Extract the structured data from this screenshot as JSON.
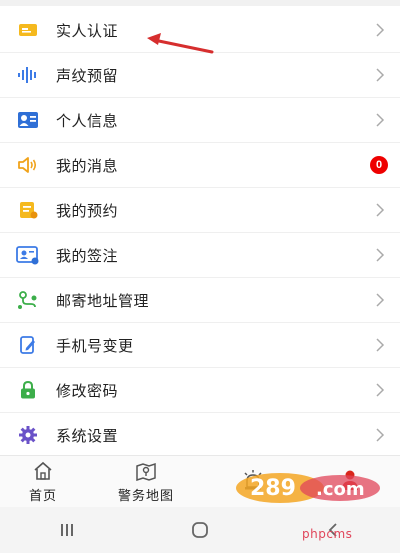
{
  "menu": {
    "items": [
      {
        "label": "实人认证",
        "icon": "id-card-icon"
      },
      {
        "label": "声纹预留",
        "icon": "voiceprint-icon"
      },
      {
        "label": "个人信息",
        "icon": "profile-card-icon"
      },
      {
        "label": "我的消息",
        "icon": "speaker-icon",
        "badge": "0"
      },
      {
        "label": "我的预约",
        "icon": "appointment-icon"
      },
      {
        "label": "我的签注",
        "icon": "visa-card-icon"
      },
      {
        "label": "邮寄地址管理",
        "icon": "map-route-icon"
      },
      {
        "label": "手机号变更",
        "icon": "edit-phone-icon"
      },
      {
        "label": "修改密码",
        "icon": "lock-icon"
      },
      {
        "label": "系统设置",
        "icon": "gear-icon"
      }
    ]
  },
  "tabbar": {
    "tabs": [
      {
        "label": "首页",
        "icon": "home-icon"
      },
      {
        "label": "警务地图",
        "icon": "police-map-icon"
      },
      {
        "label": "",
        "icon": "alarm-light-icon"
      },
      {
        "label": "",
        "icon": "user-icon"
      }
    ]
  },
  "watermark": {
    "text": "phpcms"
  },
  "colors": {
    "badge": "#ee0000",
    "annotation_arrow": "#d62e2e",
    "active_tab": "#d9261c"
  }
}
